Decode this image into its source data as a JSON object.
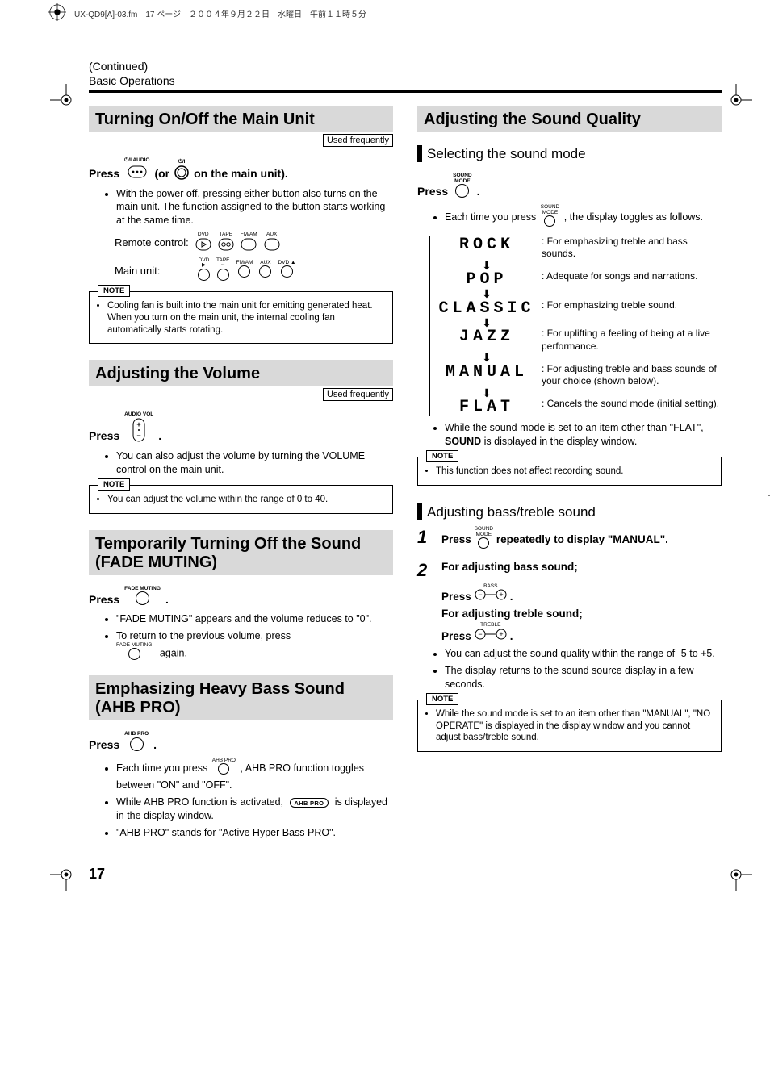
{
  "meta": {
    "header_line": "UX-QD9[A]-03.fm　17 ページ　２００４年９月２２日　水曜日　午前１１時５分"
  },
  "header": {
    "continued": "(Continued)",
    "section": "Basic Operations"
  },
  "left": {
    "s1": {
      "title": "Turning On/Off the Main Unit",
      "used": "Used frequently",
      "press_a": "Press",
      "press_b": "(or",
      "press_c": "on the main unit).",
      "audio_label": "AUDIO",
      "bullet1": "With the power off, pressing either button also turns on the main unit. The function assigned to the button starts working at the same time.",
      "remote": "Remote control:",
      "main": "Main unit:",
      "btn_dvd": "DVD",
      "btn_tape": "TAPE",
      "btn_fmam": "FM/AM",
      "btn_aux": "AUX",
      "mu_fmam": "FM/AM",
      "mu_aux": "AUX",
      "mu_dvd": "DVD",
      "note_label": "NOTE",
      "note1": "Cooling fan is built into the main unit for emitting generated heat. When you turn on the main unit, the internal cooling fan automatically starts rotating."
    },
    "s2": {
      "title": "Adjusting the Volume",
      "used": "Used frequently",
      "vol_label": "AUDIO VOL",
      "press": "Press",
      "period": ".",
      "bullet1": "You can also adjust the volume by turning the VOLUME control on the main unit.",
      "note_label": "NOTE",
      "note1": "You can adjust the volume within the range of 0 to 40."
    },
    "s3": {
      "title": "Temporarily Turning Off the Sound (FADE MUTING)",
      "fm_label": "FADE MUTING",
      "press": "Press",
      "period": ".",
      "bullet1": "\"FADE MUTING\" appears and the volume reduces to \"0\".",
      "bullet2": "To return to the previous volume, press",
      "again": "again."
    },
    "s4": {
      "title": "Emphasizing Heavy Bass Sound (AHB PRO)",
      "ahb_label": "AHB PRO",
      "press": "Press",
      "period": ".",
      "b1a": "Each time you press",
      "b1b": ", AHB PRO function toggles between \"ON\" and \"OFF\".",
      "b2a": "While AHB PRO function is activated,",
      "pill": "AHB PRO",
      "b2b": "is displayed in the display window.",
      "b3": "\"AHB PRO\" stands for \"Active Hyper Bass PRO\"."
    }
  },
  "right": {
    "s5": {
      "title": "Adjusting the Sound Quality",
      "sub1": "Selecting the sound mode",
      "sm_label": "SOUND\nMODE",
      "press": "Press",
      "period": ".",
      "b1a": "Each time you press",
      "b1b": ", the display toggles as follows.",
      "modes": {
        "rock": "ROCK",
        "rock_d": "For emphasizing treble and bass sounds.",
        "pop": "POP",
        "pop_d": "Adequate for songs and narrations.",
        "classic": "CLASSIC",
        "classic_d": "For emphasizing treble sound.",
        "jazz": "JAZZ",
        "jazz_d": "For uplifting a feeling of being at a live performance.",
        "manual": "MANUAL",
        "manual_d": "For adjusting treble and bass sounds of your choice (shown below).",
        "flat": "FLAT",
        "flat_d": "Cancels the sound mode (initial setting)."
      },
      "tail_a": "While the sound mode is set to an item other than \"FLAT\",",
      "tail_bold": "SOUND",
      "tail_b": "is displayed in the display window.",
      "note_label": "NOTE",
      "note1": "This function does not affect recording sound."
    },
    "s6": {
      "sub": "Adjusting bass/treble sound",
      "step1_a": "Press",
      "step1_b": "repeatedly to display \"MANUAL\".",
      "step2_head": "For adjusting bass sound;",
      "step2_press": "Press",
      "bass_label": "BASS",
      "step2_head2": "For adjusting treble sound;",
      "treble_label": "TREBLE",
      "period": ".",
      "b1": "You can adjust the sound quality within the range of -5 to +5.",
      "b2": "The display returns to the sound source display in a few seconds.",
      "note_label": "NOTE",
      "note1": "While the sound mode is set to an item other than \"MANUAL\", \"NO OPERATE\" is displayed in the display window and you cannot adjust bass/treble sound."
    }
  },
  "page_number": "17"
}
